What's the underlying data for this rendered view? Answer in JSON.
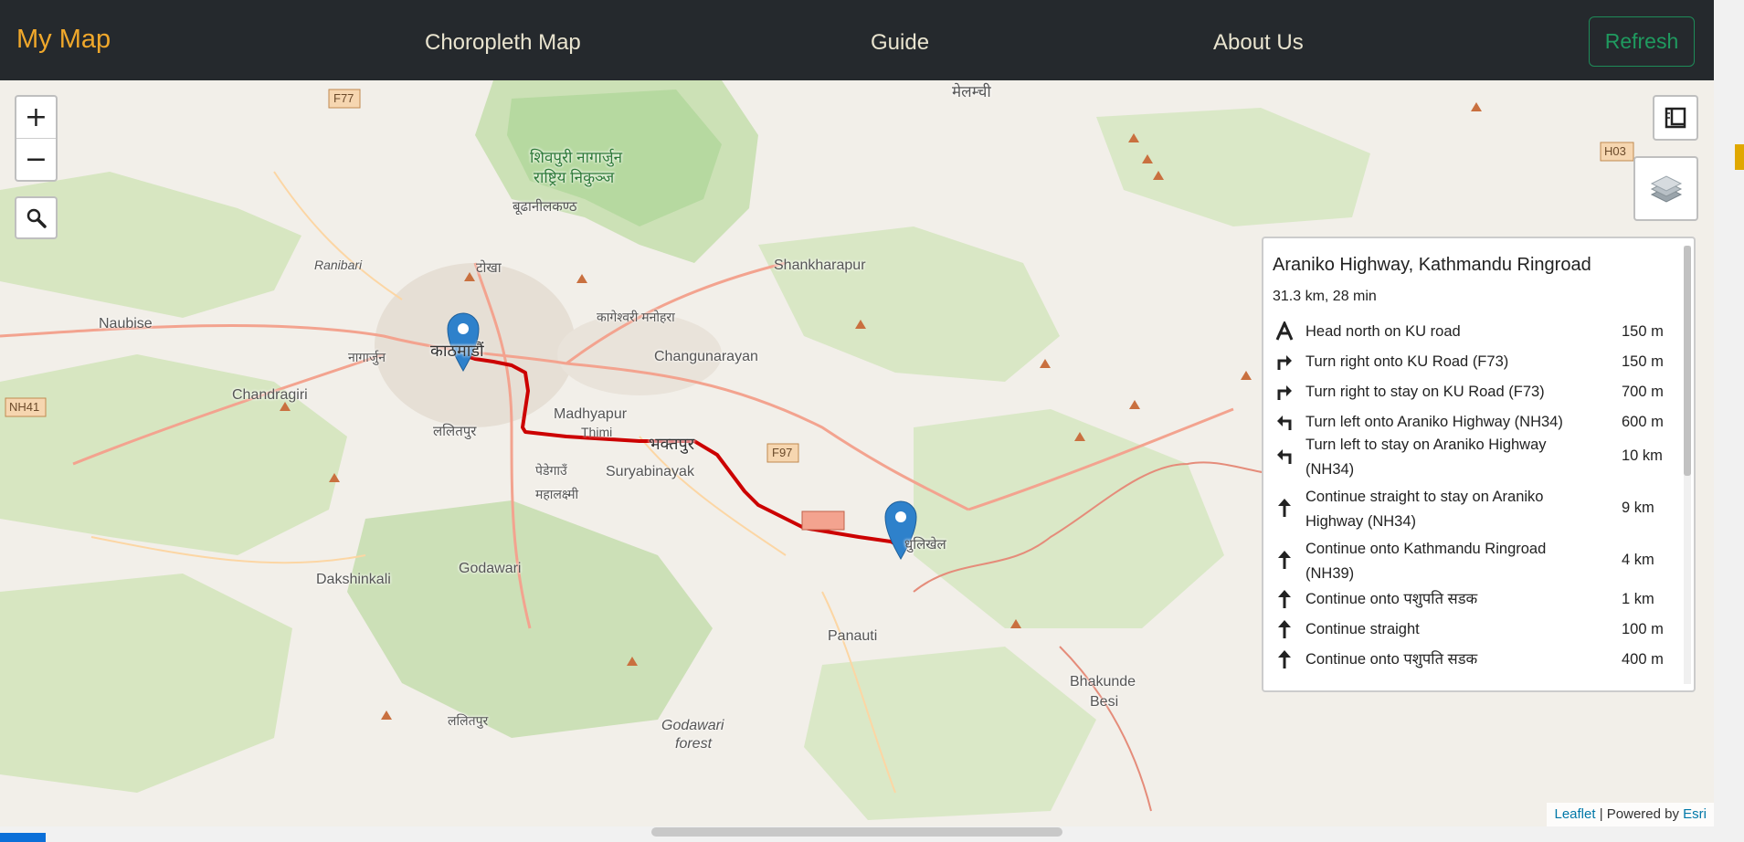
{
  "navbar": {
    "brand": "My Map",
    "links": [
      "Choropleth Map",
      "Guide",
      "About Us"
    ],
    "refresh_label": "Refresh"
  },
  "map_controls": {
    "zoom_in": "+",
    "zoom_out": "−"
  },
  "route": {
    "title": "Araniko Highway, Kathmandu Ringroad",
    "summary": "31.3 km, 28 min",
    "instructions": [
      {
        "icon": "depart-icon",
        "text": "Head north on KU road",
        "distance": "150 m"
      },
      {
        "icon": "turn-right-icon",
        "text": "Turn right onto KU Road (F73)",
        "distance": "150 m"
      },
      {
        "icon": "turn-right-icon",
        "text": "Turn right to stay on KU Road (F73)",
        "distance": "700 m"
      },
      {
        "icon": "turn-left-icon",
        "text": "Turn left onto Araniko Highway (NH34)",
        "distance": "600 m"
      },
      {
        "icon": "turn-left-icon",
        "text": "Turn left to stay on Araniko Highway (NH34)",
        "distance": "10 km"
      },
      {
        "icon": "straight-icon",
        "text": "Continue straight to stay on Araniko Highway (NH34)",
        "distance": "9 km"
      },
      {
        "icon": "straight-icon",
        "text": "Continue onto Kathmandu Ringroad (NH39)",
        "distance": "4 km"
      },
      {
        "icon": "straight-icon",
        "text": "Continue onto पशुपति सडक",
        "distance": "1 km"
      },
      {
        "icon": "straight-icon",
        "text": "Continue straight",
        "distance": "100 m"
      },
      {
        "icon": "straight-icon",
        "text": "Continue onto पशुपति सडक",
        "distance": "400 m"
      }
    ]
  },
  "attribution": {
    "leaflet": "Leaflet",
    "separator": " | Powered by ",
    "esri": "Esri"
  },
  "place_labels": {
    "melamchi": "मेलम्ची",
    "shivapuri": "शिवपुरी नागार्जुन",
    "shivapuri2": "राष्ट्रिय निकुञ्ज",
    "budhanilkantha": "बूढानीलकण्ठ",
    "ranibari": "Ranibari",
    "tokha": "टोखा",
    "shankharapur": "Shankharapur",
    "kageshwori": "कागेश्वरी मनोहरा",
    "naubise": "Naubise",
    "nagarjun": "नागार्जुन",
    "kathmandu": "काठमाडौं",
    "changunarayan": "Changunarayan",
    "chandragiri": "Chandragiri",
    "lalitpur": "ललितपुर",
    "madhyapur": "Madhyapur",
    "thimi": "Thimi",
    "bhaktapur": "भक्तपुर",
    "suryabinayak": "Suryabinayak",
    "pedegaun": "पेडेगाउँ",
    "mahalaxmi": "महालक्ष्मी",
    "dhulikhel": "धुलिखेल",
    "dakshinkali": "Dakshinkali",
    "godawari": "Godawari",
    "panauti": "Panauti",
    "bhakunde": "Bhakunde",
    "besi": "Besi",
    "lalitpur2": "ललितपुर",
    "godawari_forest": "Godawari",
    "godawari_forest2": "forest",
    "f77": "F77",
    "f97": "F97",
    "nh41": "NH41",
    "h03": "H03"
  }
}
